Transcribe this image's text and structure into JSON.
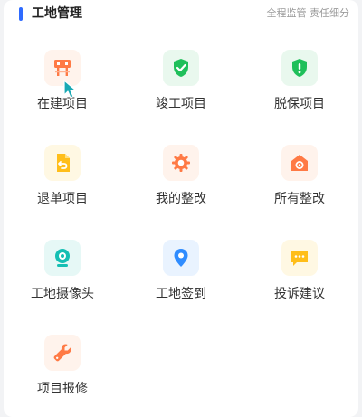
{
  "header": {
    "title": "工地管理",
    "subtitle": "全程监管 责任细分",
    "accent_color": "#2f6bff"
  },
  "tiles": [
    {
      "label": "在建项目",
      "icon": "construction-sign-icon",
      "color": "#ff7a45",
      "bg": "#fff3ec"
    },
    {
      "label": "竣工项目",
      "icon": "shield-check-icon",
      "color": "#1fbf5a",
      "bg": "#e9f8ee"
    },
    {
      "label": "脱保项目",
      "icon": "shield-alert-icon",
      "color": "#1fbf5a",
      "bg": "#e9f8ee"
    },
    {
      "label": "退单项目",
      "icon": "return-document-icon",
      "color": "#ffbe1a",
      "bg": "#fff8e3"
    },
    {
      "label": "我的整改",
      "icon": "gear-icon",
      "color": "#ff7a45",
      "bg": "#fff3ec"
    },
    {
      "label": "所有整改",
      "icon": "rectify-house-icon",
      "color": "#ff7a45",
      "bg": "#fff3ec"
    },
    {
      "label": "工地摄像头",
      "icon": "camera-icon",
      "color": "#15bfb3",
      "bg": "#e6f8f6"
    },
    {
      "label": "工地签到",
      "icon": "location-pin-icon",
      "color": "#2f8cff",
      "bg": "#e9f3ff"
    },
    {
      "label": "投诉建议",
      "icon": "chat-bubble-icon",
      "color": "#ffbe1a",
      "bg": "#fff8e3"
    },
    {
      "label": "项目报修",
      "icon": "wrench-icon",
      "color": "#ff7a45",
      "bg": "#fff3ec"
    }
  ]
}
